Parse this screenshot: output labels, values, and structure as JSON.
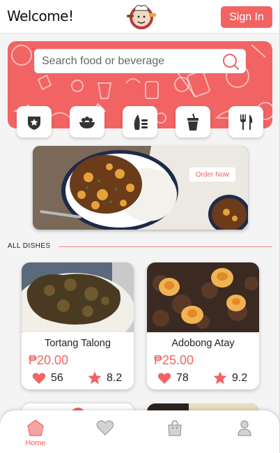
{
  "header": {
    "welcome": "Welcome!",
    "sign_in_label": "Sign In",
    "logo_icon": "chef-logo"
  },
  "search": {
    "placeholder": "Search food or beverage",
    "icon": "search-icon"
  },
  "categories": [
    {
      "icon": "badge-star-icon"
    },
    {
      "icon": "food-bowl-icon"
    },
    {
      "icon": "seafood-icon"
    },
    {
      "icon": "drink-cup-icon"
    },
    {
      "icon": "fork-knife-icon"
    }
  ],
  "banner": {
    "order_label": "Order Now"
  },
  "section": {
    "title": "ALL DISHES"
  },
  "dishes": [
    {
      "name": "Tortang Talong",
      "price": "₱20.00",
      "likes": "56",
      "rating": "8.2"
    },
    {
      "name": "Adobong Atay",
      "price": "₱25.00",
      "likes": "78",
      "rating": "9.2"
    }
  ],
  "nav": {
    "home_label": "Home",
    "items": [
      "home-icon",
      "heart-icon",
      "bag-icon",
      "user-icon"
    ]
  },
  "colors": {
    "accent": "#f26363",
    "background": "#f4f4f4"
  }
}
